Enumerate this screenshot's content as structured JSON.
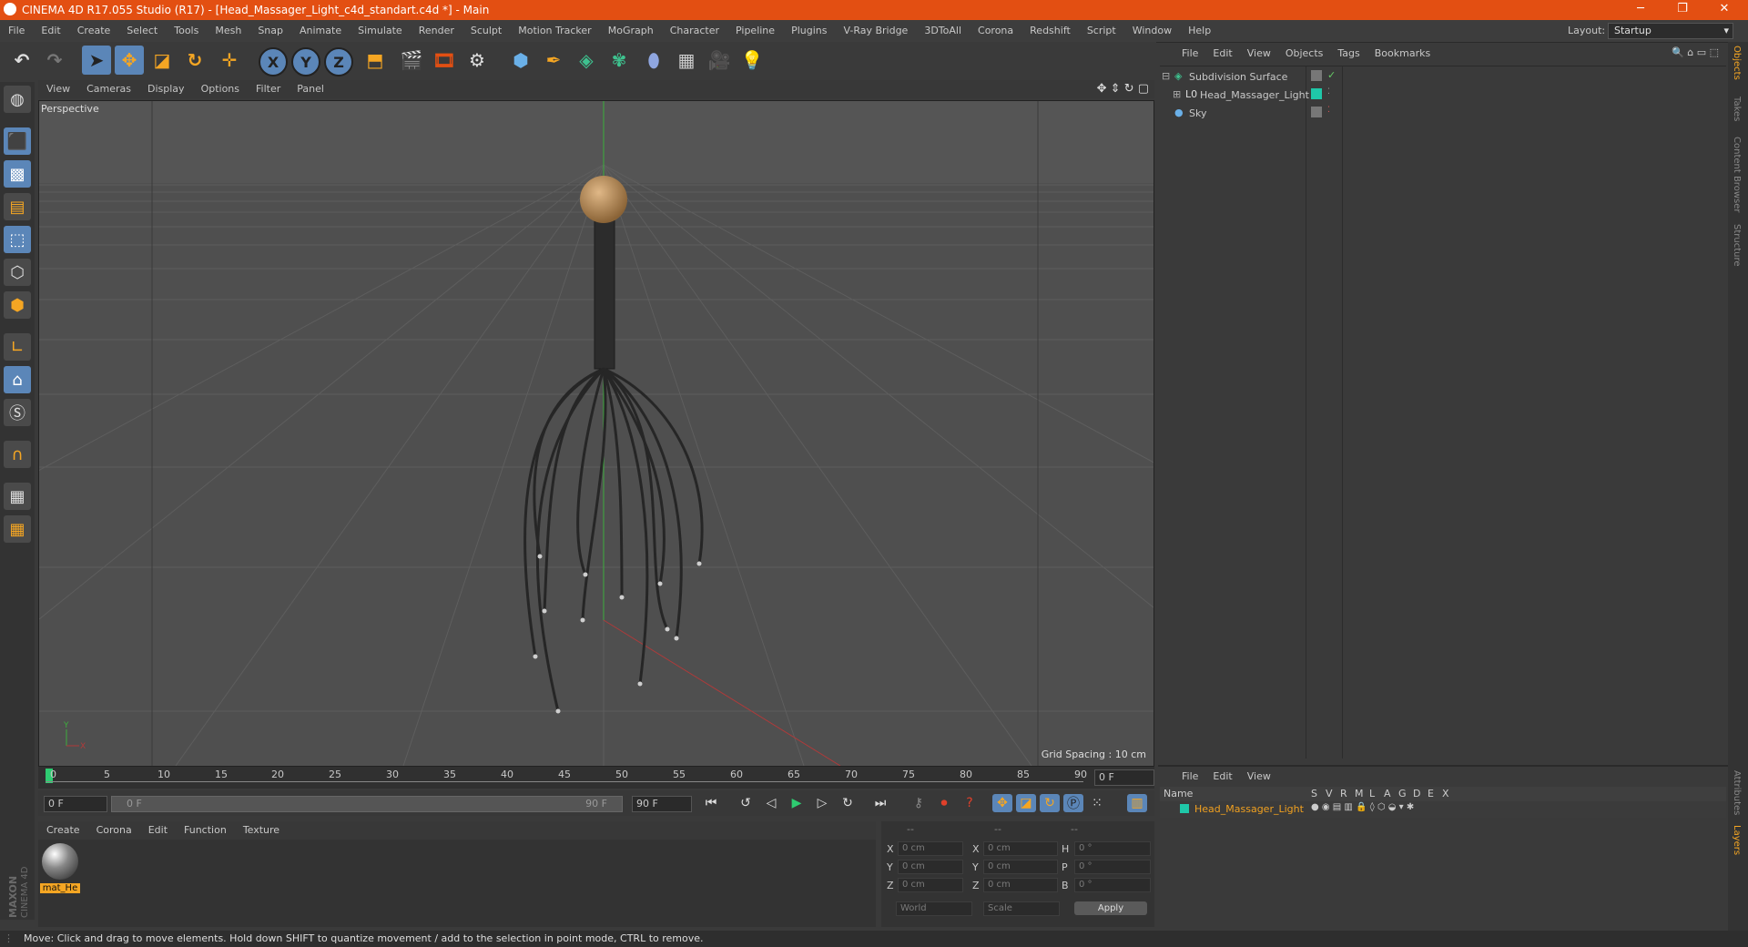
{
  "window": {
    "title": "CINEMA 4D R17.055 Studio (R17) - [Head_Massager_Light_c4d_standart.c4d *] - Main",
    "minimize": "─",
    "maximize": "❐",
    "close": "✕"
  },
  "menu": [
    "File",
    "Edit",
    "Create",
    "Select",
    "Tools",
    "Mesh",
    "Snap",
    "Animate",
    "Simulate",
    "Render",
    "Sculpt",
    "Motion Tracker",
    "MoGraph",
    "Character",
    "Pipeline",
    "Plugins",
    "V-Ray Bridge",
    "3DToAll",
    "Corona",
    "Redshift",
    "Script",
    "Window",
    "Help"
  ],
  "layout": {
    "label": "Layout:",
    "value": "Startup"
  },
  "toolbar": {
    "x_axis": "X",
    "y_axis": "Y",
    "z_axis": "Z"
  },
  "viewport": {
    "menu": [
      "View",
      "Cameras",
      "Display",
      "Options",
      "Filter",
      "Panel"
    ],
    "label": "Perspective",
    "grid_spacing": "Grid Spacing : 10 cm"
  },
  "timeline": {
    "ticks": [
      "0",
      "5",
      "10",
      "15",
      "20",
      "25",
      "30",
      "35",
      "40",
      "45",
      "50",
      "55",
      "60",
      "65",
      "70",
      "75",
      "80",
      "85",
      "90"
    ],
    "current_frame": "0 F",
    "start_frame": "0 F",
    "range_start": "0 F",
    "range_end": "90 F",
    "end_frame": "90 F"
  },
  "material_panel": {
    "menu": [
      "Create",
      "Corona",
      "Edit",
      "Function",
      "Texture"
    ],
    "material_name": "mat_He"
  },
  "coords": {
    "header": [
      "--",
      "--",
      "--"
    ],
    "rows": [
      {
        "a": "X",
        "av": "0 cm",
        "b": "X",
        "bv": "0 cm",
        "c": "H",
        "cv": "0 °"
      },
      {
        "a": "Y",
        "av": "0 cm",
        "b": "Y",
        "bv": "0 cm",
        "c": "P",
        "cv": "0 °"
      },
      {
        "a": "Z",
        "av": "0 cm",
        "b": "Z",
        "bv": "0 cm",
        "c": "B",
        "cv": "0 °"
      }
    ],
    "space": "World",
    "mode": "Scale",
    "apply": "Apply"
  },
  "object_manager": {
    "menu": [
      "File",
      "Edit",
      "View",
      "Objects",
      "Tags",
      "Bookmarks"
    ],
    "objects": [
      {
        "name": "Subdivision Surface",
        "indent": 0
      },
      {
        "name": "Head_Massager_Light",
        "indent": 1
      },
      {
        "name": "Sky",
        "indent": 0
      }
    ]
  },
  "layer_manager": {
    "menu": [
      "File",
      "Edit",
      "View"
    ],
    "columns": [
      "Name",
      "S",
      "V",
      "R",
      "M",
      "L",
      "A",
      "G",
      "D",
      "E",
      "X"
    ],
    "layer_name": "Head_Massager_Light",
    "layer_color": "#1fc7a8"
  },
  "side_tabs": [
    "Objects",
    "Takes",
    "Content Browser",
    "Structure",
    "Attributes",
    "Layers"
  ],
  "brand": {
    "maker": "MAXON",
    "product": "CINEMA 4D"
  },
  "status": "Move: Click and drag to move elements. Hold down SHIFT to quantize movement / add to the selection in point mode, CTRL to remove.",
  "colors": {
    "titlebar": "#e34f12",
    "accent_blue": "#5b86b8",
    "layer_name": "#f0a020"
  }
}
